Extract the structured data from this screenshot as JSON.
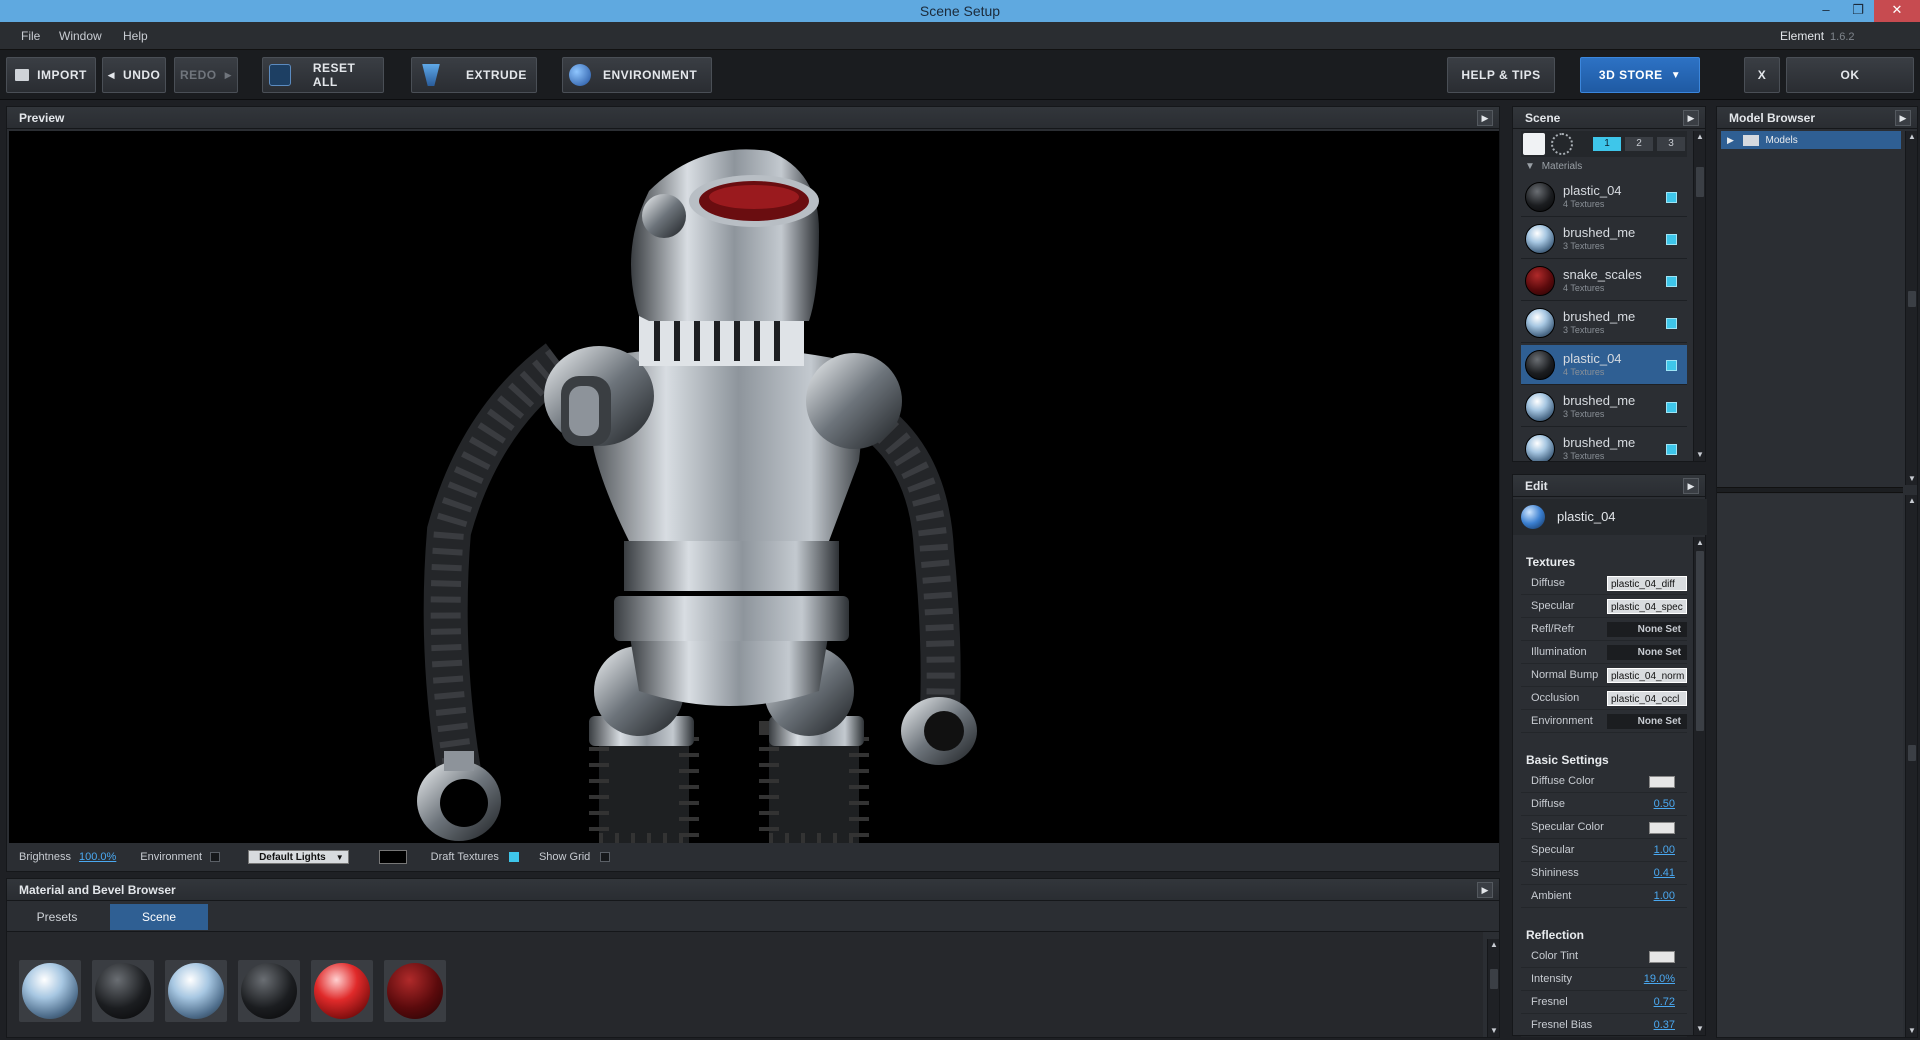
{
  "window": {
    "title": "Scene Setup",
    "minimize_glyph": "–",
    "restore_glyph": "❐",
    "close_glyph": "✕"
  },
  "menu": {
    "items": [
      "File",
      "Window",
      "Help"
    ],
    "product": "Element",
    "version": "1.6.2"
  },
  "toolbar": {
    "import": "IMPORT",
    "undo": "UNDO",
    "redo": "REDO",
    "reset_all": "RESET ALL",
    "extrude": "EXTRUDE",
    "environment": "ENVIRONMENT",
    "help_tips": "HELP & TIPS",
    "store": "3D STORE",
    "cancel": "X",
    "ok": "OK"
  },
  "preview": {
    "title": "Preview",
    "brightness_label": "Brightness",
    "brightness_value": "100.0%",
    "environment_label": "Environment",
    "lights_select": "Default Lights",
    "draft_textures_label": "Draft Textures",
    "show_grid_label": "Show Grid"
  },
  "browser": {
    "title": "Material and Bevel Browser",
    "tabs": [
      "Presets",
      "Scene"
    ],
    "selected_tab": "Scene"
  },
  "scene": {
    "title": "Scene",
    "layers": [
      "1",
      "2",
      "3"
    ],
    "materials_header": "Materials",
    "materials": [
      {
        "name": "plastic_04",
        "sub": "4 Textures",
        "ball": "black"
      },
      {
        "name": "brushed_me",
        "sub": "3 Textures",
        "ball": "chrome"
      },
      {
        "name": "snake_scales",
        "sub": "4 Textures",
        "ball": "red"
      },
      {
        "name": "brushed_me",
        "sub": "3 Textures",
        "ball": "chrome"
      },
      {
        "name": "plastic_04",
        "sub": "4 Textures",
        "ball": "black",
        "selected": true
      },
      {
        "name": "brushed_me",
        "sub": "3 Textures",
        "ball": "chrome"
      },
      {
        "name": "brushed_me",
        "sub": "3 Textures",
        "ball": "chrome"
      }
    ]
  },
  "edit": {
    "title": "Edit",
    "material_name": "plastic_04",
    "textures_header": "Textures",
    "textures": [
      {
        "label": "Diffuse",
        "value": "plastic_04_diff",
        "set": true
      },
      {
        "label": "Specular",
        "value": "plastic_04_spec",
        "set": true
      },
      {
        "label": "Refl/Refr",
        "value": "None Set",
        "set": false
      },
      {
        "label": "Illumination",
        "value": "None Set",
        "set": false
      },
      {
        "label": "Normal Bump",
        "value": "plastic_04_norm",
        "set": true
      },
      {
        "label": "Occlusion",
        "value": "plastic_04_occl",
        "set": true
      },
      {
        "label": "Environment",
        "value": "None Set",
        "set": false
      }
    ],
    "basic_header": "Basic Settings",
    "basic": [
      {
        "label": "Diffuse Color",
        "swatch": true
      },
      {
        "label": "Diffuse",
        "value": "0.50"
      },
      {
        "label": "Specular Color",
        "swatch": true
      },
      {
        "label": "Specular",
        "value": "1.00"
      },
      {
        "label": "Shininess",
        "value": "0.41"
      },
      {
        "label": "Ambient",
        "value": "1.00"
      }
    ],
    "reflection_header": "Reflection",
    "reflection": [
      {
        "label": "Color Tint",
        "swatch": true
      },
      {
        "label": "Intensity",
        "value": "19.0%"
      },
      {
        "label": "Fresnel",
        "value": "0.72"
      },
      {
        "label": "Fresnel Bias",
        "value": "0.37"
      }
    ]
  },
  "model_browser": {
    "title": "Model Browser",
    "root": "Models"
  },
  "colors": {
    "accent": "#2f5f93",
    "check": "#3ec6ea",
    "titlebar": "#5fa9e0",
    "link": "#4aa8f0"
  }
}
